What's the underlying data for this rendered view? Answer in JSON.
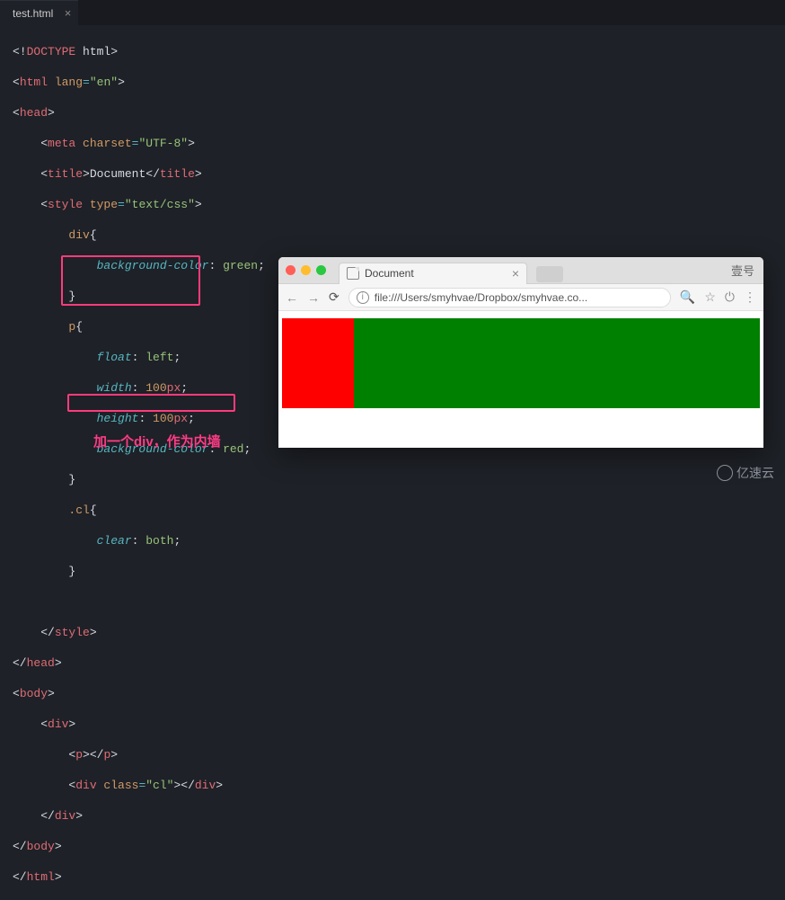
{
  "editor_tab": {
    "filename": "test.html"
  },
  "code": {
    "l1": {
      "a": "<!",
      "b": "DOCTYPE",
      "c": " html",
      "d": ">"
    },
    "l2": {
      "a": "<",
      "b": "html",
      "c": " lang",
      "d": "=",
      "e": "\"en\"",
      "f": ">"
    },
    "l3": {
      "a": "<",
      "b": "head",
      "c": ">"
    },
    "l4": {
      "a": "    <",
      "b": "meta",
      "c": " charset",
      "d": "=",
      "e": "\"UTF-8\"",
      "f": ">"
    },
    "l5": {
      "a": "    <",
      "b": "title",
      "c": ">",
      "d": "Document",
      "e": "</",
      "f": "title",
      "g": ">"
    },
    "l6": {
      "a": "    <",
      "b": "style",
      "c": " type",
      "d": "=",
      "e": "\"text/css\"",
      "f": ">"
    },
    "l7": {
      "a": "        ",
      "b": "div",
      "c": "{"
    },
    "l8": {
      "a": "            ",
      "b": "background-color",
      "c": ": ",
      "d": "green",
      "e": ";"
    },
    "l9": {
      "a": "        }"
    },
    "l10": {
      "a": "        ",
      "b": "p",
      "c": "{"
    },
    "l11": {
      "a": "            ",
      "b": "float",
      "c": ": ",
      "d": "left",
      "e": ";"
    },
    "l12": {
      "a": "            ",
      "b": "width",
      "c": ": ",
      "d": "100",
      "e": "px",
      "f": ";"
    },
    "l13": {
      "a": "            ",
      "b": "height",
      "c": ": ",
      "d": "100",
      "e": "px",
      "f": ";"
    },
    "l14": {
      "a": "            ",
      "b": "background-color",
      "c": ": ",
      "d": "red",
      "e": ";"
    },
    "l15": {
      "a": "        }"
    },
    "l16": {
      "a": "        ",
      "b": ".cl",
      "c": "{"
    },
    "l17": {
      "a": "            ",
      "b": "clear",
      "c": ": ",
      "d": "both",
      "e": ";"
    },
    "l18": {
      "a": "        }"
    },
    "l19": {
      "a": "    </",
      "b": "style",
      "c": ">"
    },
    "l20": {
      "a": "</",
      "b": "head",
      "c": ">"
    },
    "l21": {
      "a": "<",
      "b": "body",
      "c": ">"
    },
    "l22": {
      "a": "    <",
      "b": "div",
      "c": ">"
    },
    "l23": {
      "a": "        <",
      "b": "p",
      "c": "></",
      "d": "p",
      "e": ">"
    },
    "l24": {
      "a": "        <",
      "b": "div",
      "c": " class",
      "d": "=",
      "e": "\"cl\"",
      "f": "></",
      "g": "div",
      "h": ">"
    },
    "l25": {
      "a": "    </",
      "b": "div",
      "c": ">"
    },
    "l26": {
      "a": "</",
      "b": "body",
      "c": ">"
    },
    "l27": {
      "a": "</",
      "b": "html",
      "c": ">"
    }
  },
  "annotation": "加一个div，作为内墙",
  "browser": {
    "tab_title": "Document",
    "url": "file:///Users/smyhvae/Dropbox/smyhvae.co...",
    "account": "壹号"
  },
  "watermark": "亿速云"
}
